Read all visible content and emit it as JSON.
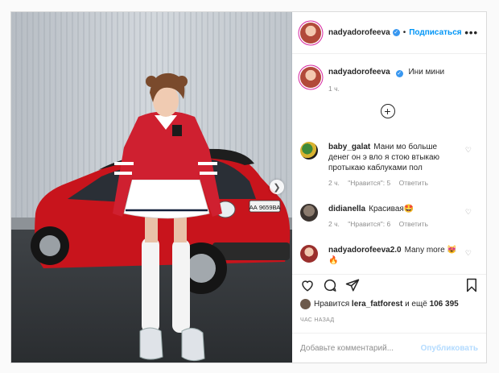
{
  "header": {
    "username": "nadyadorofeeva",
    "separator": "•",
    "follow_label": "Подписаться",
    "more_label": "•••"
  },
  "caption": {
    "username": "nadyadorofeeva",
    "text": "Ини мини",
    "time": "1 ч."
  },
  "load_more_label": "+",
  "comments": [
    {
      "username": "baby_galat",
      "text": "Мани мо больше денег он э вло я стою втыкаю протыкаю каблуками пол",
      "time": "2 ч.",
      "likes": "\"Нравится\": 5",
      "reply": "Ответить"
    },
    {
      "username": "didianella",
      "text": "Красивая🤩",
      "time": "2 ч.",
      "likes": "\"Нравится\": 6",
      "reply": "Ответить"
    },
    {
      "username": "nadyadorofeeva2.0",
      "text": "Many more 😻🔥"
    }
  ],
  "icons": {
    "like": "heart-icon",
    "comment": "speech-bubble-icon",
    "share": "paper-plane-icon",
    "save": "bookmark-icon",
    "next": "chevron-right-icon"
  },
  "likes_line": {
    "prefix": "Нравится",
    "user": "lera_fatforest",
    "and_more": "и ещё",
    "count": "106 395"
  },
  "posted_ago": "ЧАС НАЗАД",
  "add_comment": {
    "placeholder": "Добавьте комментарий...",
    "publish_label": "Опубликовать"
  },
  "photo": {
    "license_plate": "АА 9659ВА"
  }
}
